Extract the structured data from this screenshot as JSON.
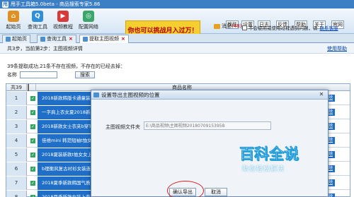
{
  "window": {
    "title": "甩手工具箱5.0beta - 商品搜索专家5.86"
  },
  "toolbar": {
    "tools": [
      {
        "label": "起始页",
        "icon": "home-icon"
      },
      {
        "label": "查询工具",
        "icon": "search-tool-icon"
      },
      {
        "label": "视频教程",
        "icon": "video-icon"
      },
      {
        "label": "配置网络",
        "icon": "network-icon"
      }
    ],
    "banner": "你也可以挑战月入过万！",
    "buttons": [
      "换肤",
      "设置",
      "日志",
      "反馈",
      "帮助",
      "关于",
      "官网"
    ],
    "messages_label": "消息",
    "messages_count": "(48)",
    "notice": "不会使用或使用过程遇到问题，请",
    "notice_link": "联系客服"
  },
  "tabs": [
    {
      "label": "起始页"
    },
    {
      "label": "查询工具"
    },
    {
      "label": "提取主图视频"
    }
  ],
  "steps": {
    "text": "共3步，当前第2步：主图视频详情",
    "help": "使用帮助"
  },
  "info": "39条提取成功,21条不存在视频，不存在的已经去掉：",
  "name_filter": {
    "label": "名称",
    "button": "搜索"
  },
  "table": {
    "count_header": "共39",
    "name_header": "商品名称",
    "rows": [
      {
        "num": "1",
        "name": "2018新款韩版卡通童装男",
        "action": "删除"
      },
      {
        "num": "2",
        "name": "一字肩上衣女夏2018新款",
        "action": "删除"
      },
      {
        "num": "3",
        "name": "2018新款女士衣夹b穿T恤",
        "action": "删除"
      },
      {
        "num": "4",
        "name": "佳维mini 韩范短袖t恤女",
        "action": "删除"
      },
      {
        "num": "5",
        "name": "2018夏装新款t恤女女上衣",
        "action": "删除"
      },
      {
        "num": "6",
        "name": "b理衡风复古衬衫女装连",
        "action": "删除"
      },
      {
        "num": "7",
        "name": "2018夏季新款韩国气质",
        "action": "删除"
      },
      {
        "num": "8",
        "name": "2018夏季新款女装上衣",
        "action": "删除"
      }
    ]
  },
  "dialog": {
    "title": "设置导出主图视频的位置",
    "folder_label": "主图视频文件夹",
    "folder_value": "E:\\商品视频\\主图视频20180709153958",
    "confirm": "确认导出",
    "cancel": "取消"
  },
  "watermark": {
    "logo": "百科全说",
    "sub": "助你轻松解决"
  },
  "colors": {
    "titlebar": "#3d7fc4",
    "row_highlight": "#1f6fc9",
    "banner": "#f5ce30",
    "accent_red": "#d62020"
  }
}
